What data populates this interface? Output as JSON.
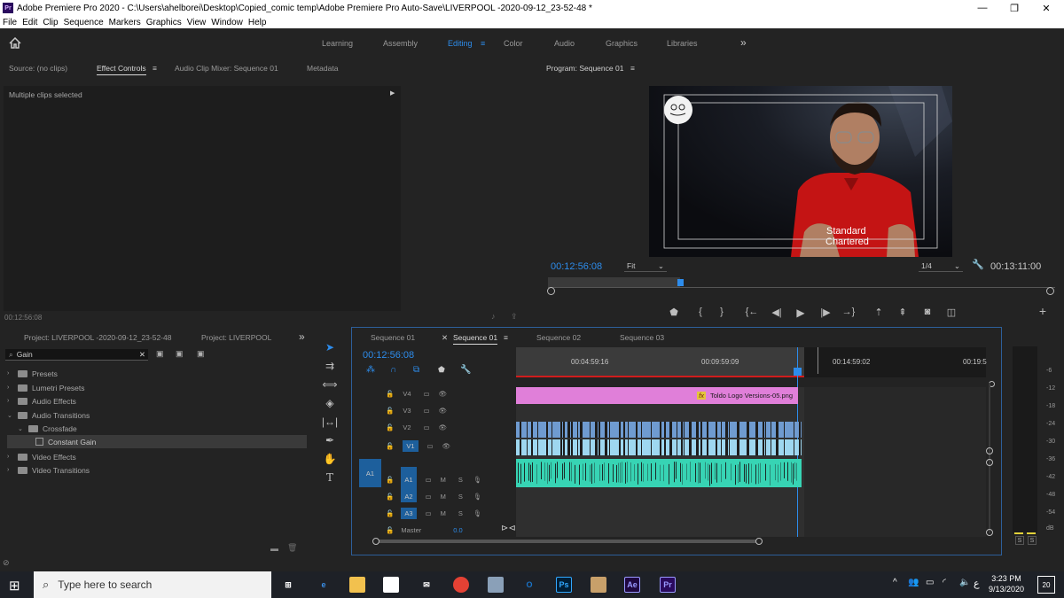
{
  "window": {
    "title": "Adobe Premiere Pro 2020 - C:\\Users\\ahelborei\\Desktop\\Copied_comic temp\\Adobe Premiere Pro Auto-Save\\LIVERPOOL -2020-09-12_23-52-48 *",
    "app_badge": "Pr",
    "minimize": "—",
    "restore": "❐",
    "close": "✕"
  },
  "menu": [
    "File",
    "Edit",
    "Clip",
    "Sequence",
    "Markers",
    "Graphics",
    "View",
    "Window",
    "Help"
  ],
  "workspaces": {
    "items": [
      "Learning",
      "Assembly",
      "Editing",
      "Color",
      "Audio",
      "Graphics",
      "Libraries"
    ],
    "active": "Editing",
    "more": "»"
  },
  "source_panel": {
    "tabs": [
      "Source: (no clips)",
      "Effect Controls",
      "Audio Clip Mixer: Sequence 01",
      "Metadata"
    ],
    "active_tab": "Effect Controls",
    "status": "Multiple clips selected",
    "timecode": "00:12:56:08"
  },
  "program": {
    "title": "Program: Sequence 01",
    "timecode_current": "00:12:56:08",
    "fit": "Fit",
    "resolution": "1/4",
    "timecode_total": "00:13:11:00",
    "shirt_text_1": "Standard",
    "shirt_text_2": "Chartered",
    "playhead_progress": 0.98,
    "buttons": [
      "marker-icon",
      "mark-in-icon",
      "mark-out-icon",
      "go-to-in-icon",
      "step-back-icon",
      "play-icon",
      "step-forward-icon",
      "go-to-out-icon",
      "lift-icon",
      "extract-icon",
      "export-frame-icon",
      "comparison-view-icon",
      "add-button-icon"
    ],
    "add": "+"
  },
  "project": {
    "tabs": [
      "Project: LIVERPOOL -2020-09-12_23-52-48",
      "Project: LIVERPOOL"
    ],
    "more": "»",
    "search_value": "Gain",
    "tree": [
      {
        "label": "Presets",
        "indent": 0,
        "open": false
      },
      {
        "label": "Lumetri Presets",
        "indent": 0,
        "open": false
      },
      {
        "label": "Audio Effects",
        "indent": 0,
        "open": false
      },
      {
        "label": "Audio Transitions",
        "indent": 0,
        "open": true
      },
      {
        "label": "Crossfade",
        "indent": 1,
        "open": true
      },
      {
        "label": "Constant Gain",
        "indent": 2,
        "selected": true
      },
      {
        "label": "Video Effects",
        "indent": 0,
        "open": false
      },
      {
        "label": "Video Transitions",
        "indent": 0,
        "open": false
      }
    ]
  },
  "timeline": {
    "tabs": [
      "Sequence 01",
      "Sequence 01",
      "Sequence 02",
      "Sequence 03"
    ],
    "active_tab_index": 1,
    "timecode": "00:12:56:08",
    "ruler": [
      "00:04:59:16",
      "00:09:59:09",
      "00:14:59:02",
      "00:19:5"
    ],
    "tracks": [
      {
        "name": "V4",
        "type": "video"
      },
      {
        "name": "V3",
        "type": "video"
      },
      {
        "name": "V2",
        "type": "video"
      },
      {
        "name": "V1",
        "type": "video",
        "target": true
      },
      {
        "name": "A1",
        "type": "audio",
        "target": true,
        "source": "A1"
      },
      {
        "name": "A2",
        "type": "audio"
      },
      {
        "name": "A3",
        "type": "audio"
      }
    ],
    "master": {
      "label": "Master",
      "value": "0.0"
    },
    "v4_clip": "Toldo Logo Versions-05.png",
    "fx": "fx",
    "mute": "M",
    "solo": "S"
  },
  "meter": {
    "labels": [
      "-6",
      "-12",
      "-18",
      "-24",
      "-30",
      "-36",
      "-42",
      "-48",
      "-54",
      "dB"
    ],
    "solo": [
      "S",
      "S"
    ]
  },
  "taskbar": {
    "search_placeholder": "Type here to search",
    "time": "3:23 PM",
    "date": "9/13/2020",
    "lang": "ع",
    "notification_count": "20",
    "apps": [
      {
        "name": "task-view-icon",
        "label": "⊞",
        "color": "#ffffff"
      },
      {
        "name": "edge-icon",
        "label": "e",
        "color": "#3a8ee6"
      },
      {
        "name": "file-explorer-icon",
        "label": "",
        "color": "#f2c14e"
      },
      {
        "name": "store-icon",
        "label": "",
        "color": "#ffffff"
      },
      {
        "name": "mail-icon",
        "label": "✉",
        "color": "#ffffff"
      },
      {
        "name": "chrome-icon",
        "label": "",
        "color": "#e44134"
      },
      {
        "name": "app-icon",
        "label": "",
        "color": "#8aa0b8"
      },
      {
        "name": "outlook-icon",
        "label": "O",
        "color": "#1a73c8"
      },
      {
        "name": "photoshop-icon",
        "label": "Ps",
        "color": "#31a8ff"
      },
      {
        "name": "paint-icon",
        "label": "",
        "color": "#c8a06a"
      },
      {
        "name": "after-effects-icon",
        "label": "Ae",
        "color": "#9999ff"
      },
      {
        "name": "premiere-icon",
        "label": "Pr",
        "color": "#9999ff"
      }
    ]
  }
}
